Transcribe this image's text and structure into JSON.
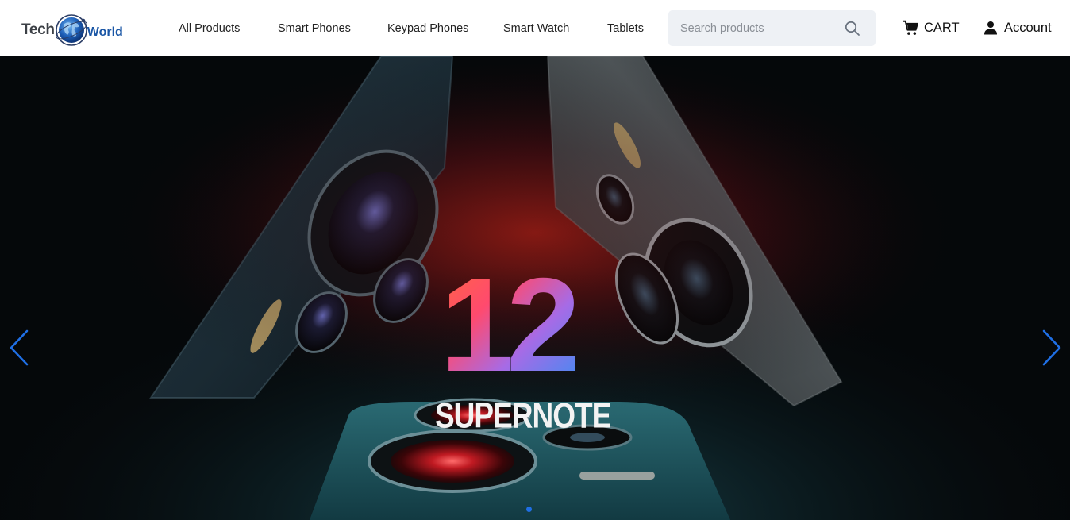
{
  "brand": {
    "word1": "Tech",
    "word2": "World"
  },
  "nav": [
    {
      "label": "All Products"
    },
    {
      "label": "Smart Phones"
    },
    {
      "label": "Keypad Phones"
    },
    {
      "label": "Smart Watch"
    },
    {
      "label": "Tablets"
    }
  ],
  "search": {
    "placeholder": "Search products",
    "value": ""
  },
  "cart": {
    "label": "CART"
  },
  "account": {
    "label": "Account"
  },
  "hero": {
    "number": "12",
    "product": "SUPERNOTE",
    "slide_count": 1,
    "active_slide": 1
  },
  "colors": {
    "accent": "#1f6fe5",
    "brand_blue": "#1b57a6",
    "search_bg": "#eef1f5"
  },
  "icons": {
    "search": "search-icon",
    "cart": "cart-icon",
    "account": "user-icon",
    "prev": "chevron-left-icon",
    "next": "chevron-right-icon"
  }
}
